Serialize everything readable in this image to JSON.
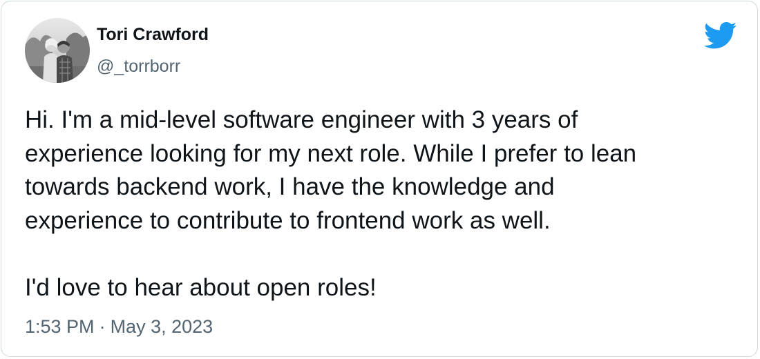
{
  "author": {
    "display_name": "Tori Crawford",
    "handle": "@_torrborr"
  },
  "tweet": {
    "text": "Hi. I'm a mid-level software engineer with 3 years of\nexperience looking for my next role. While I prefer to lean\ntowards backend work, I have the knowledge and\nexperience to contribute to frontend work as well.\n\nI'd love to hear about open roles!",
    "time": "1:53 PM",
    "separator": "·",
    "date": "May 3, 2023"
  },
  "icons": {
    "platform": "twitter-bird-icon",
    "avatar": "profile-photo"
  },
  "colors": {
    "brand": "#1d9bf0",
    "text": "#0f1419",
    "muted": "#536471",
    "border": "#cfd9de"
  }
}
